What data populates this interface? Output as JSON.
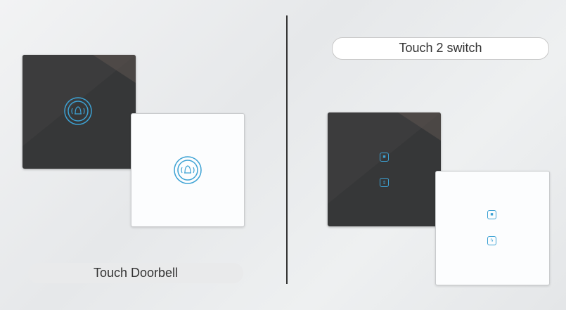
{
  "left": {
    "label": "Touch Doorbell",
    "icon": "bell-icon"
  },
  "right": {
    "label": "Touch 2 switch",
    "icons": [
      "light-icon",
      "curtain-icon",
      "power-icon"
    ]
  },
  "colors": {
    "accent": "#3da2d4",
    "dark_panel": "#363738",
    "white_panel": "#fcfdfe"
  }
}
